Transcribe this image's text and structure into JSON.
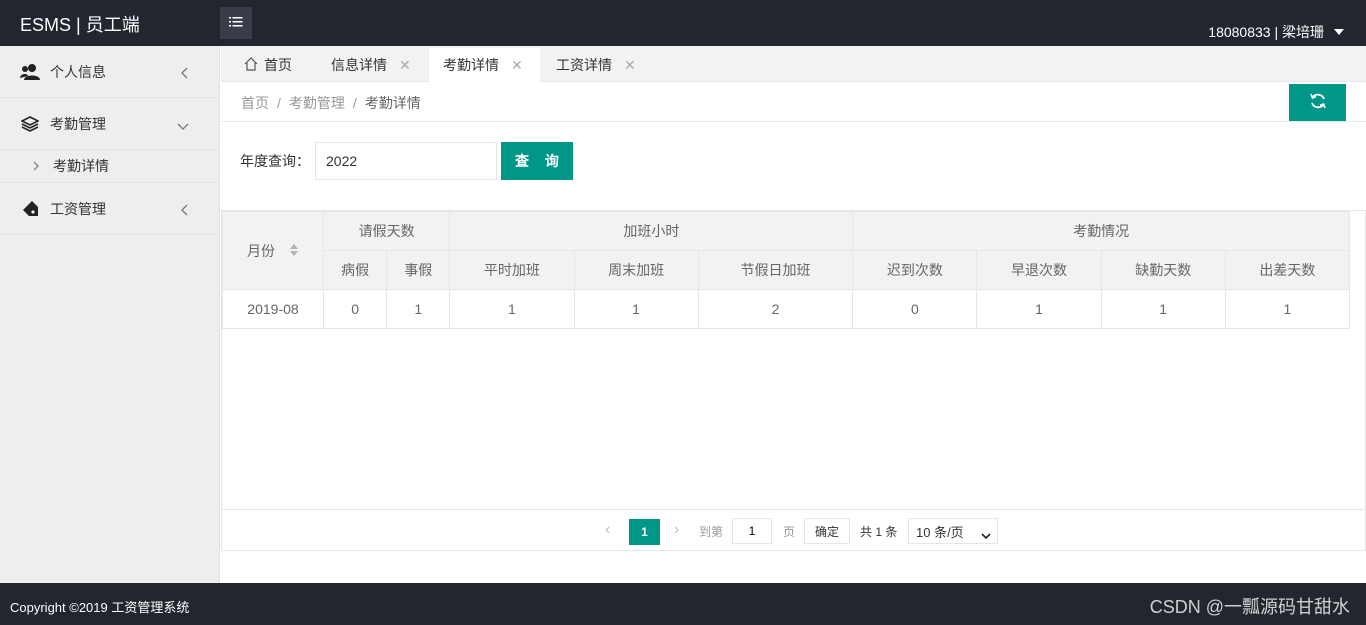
{
  "header": {
    "brand": "ESMS | 员工端",
    "user": "18080833 | 梁培珊"
  },
  "sidebar": {
    "items": [
      {
        "label": "个人信息",
        "icon": "users-icon"
      },
      {
        "label": "考勤管理",
        "icon": "layers-icon",
        "children": [
          {
            "label": "考勤详情"
          }
        ]
      },
      {
        "label": "工资管理",
        "icon": "tag-icon"
      }
    ]
  },
  "tabs": [
    {
      "label": "首页",
      "icon": "home-icon",
      "closable": false
    },
    {
      "label": "信息详情",
      "closable": true
    },
    {
      "label": "考勤详情",
      "closable": true,
      "active": true
    },
    {
      "label": "工资详情",
      "closable": true
    }
  ],
  "breadcrumb": {
    "items": [
      "首页",
      "考勤管理",
      "考勤详情"
    ],
    "separator": "/"
  },
  "search": {
    "label": "年度查询：",
    "value": "2022",
    "button": "查 询"
  },
  "table": {
    "month_header": "月份",
    "groups": [
      "请假天数",
      "加班小时",
      "考勤情况"
    ],
    "columns": [
      "病假",
      "事假",
      "平时加班",
      "周末加班",
      "节假日加班",
      "迟到次数",
      "早退次数",
      "缺勤天数",
      "出差天数"
    ],
    "rows": [
      {
        "month": "2019-08",
        "values": [
          "0",
          "1",
          "1",
          "1",
          "2",
          "0",
          "1",
          "1",
          "1"
        ]
      }
    ]
  },
  "pager": {
    "current": "1",
    "goto_label": "到第",
    "goto_value": "1",
    "page_unit": "页",
    "confirm": "确定",
    "total": "共 1 条",
    "page_size": "10 条/页"
  },
  "footer": {
    "copyright": "Copyright ©2019 工资管理系统",
    "watermark": "CSDN @一瓢源码甘甜水"
  },
  "colors": {
    "accent": "#009688",
    "header_bg": "#23262e"
  }
}
